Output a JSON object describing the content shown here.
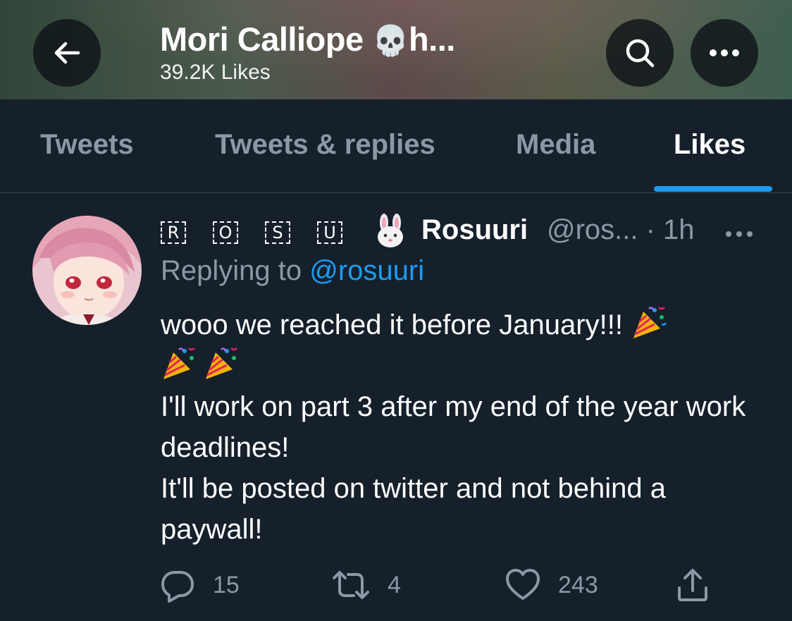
{
  "header": {
    "title": "Mori Calliope",
    "title_suffix": "h...",
    "title_emoji": "💀",
    "subtitle": "39.2K Likes"
  },
  "tabs": [
    {
      "label": "Tweets",
      "active": false
    },
    {
      "label": "Tweets & replies",
      "active": false
    },
    {
      "label": "Media",
      "active": false
    },
    {
      "label": "Likes",
      "active": true
    }
  ],
  "tweet": {
    "boxed_letters": [
      "R",
      "O",
      "S",
      "U"
    ],
    "name_emoji": "🐰",
    "display_name": "Rosuuri",
    "handle_time": "@ros... · 1h",
    "reply_prefix": "Replying to",
    "reply_mention": "@rosuuri",
    "body": {
      "line1": "wooo we reached it before January!!!",
      "line2": "I'll work on part 3 after my end of the year work deadlines!",
      "line3": "It'll be posted on twitter and not behind a paywall!"
    },
    "actions": {
      "replies": "15",
      "retweets": "4",
      "likes": "243"
    }
  },
  "colors": {
    "background": "#15202b",
    "accent": "#1d9bf0",
    "secondary_text": "#8b98a5",
    "divider": "#38444d"
  }
}
